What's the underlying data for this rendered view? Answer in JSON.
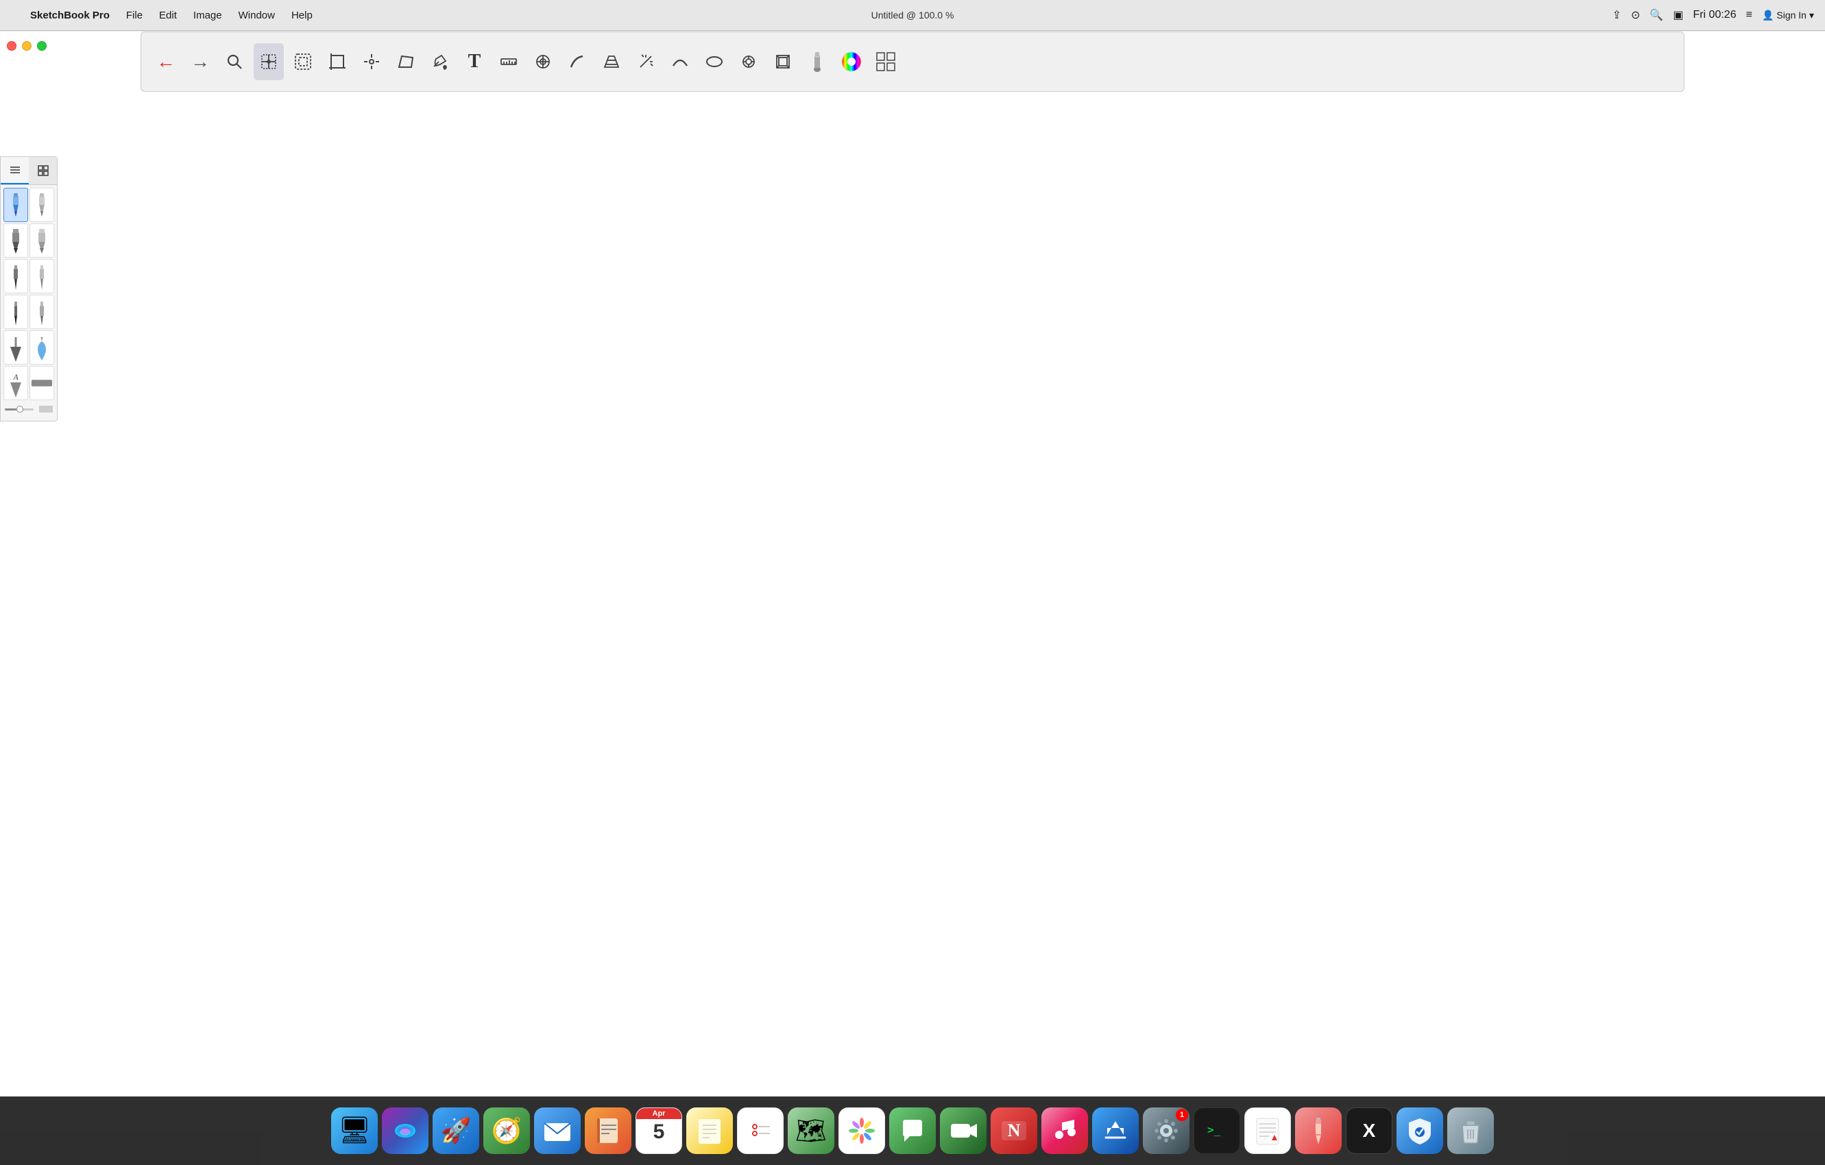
{
  "menubar": {
    "title": "Untitled @ 100.0 %",
    "apple_label": "",
    "app_name": "SketchBook Pro",
    "menus": [
      "File",
      "Edit",
      "Image",
      "Window",
      "Help"
    ],
    "time": "Fri 00:26",
    "sign_in": "Sign In"
  },
  "toolbar": {
    "buttons": [
      {
        "name": "undo",
        "icon": "←",
        "label": "Undo"
      },
      {
        "name": "redo",
        "icon": "→",
        "label": "Redo"
      },
      {
        "name": "zoom",
        "icon": "🔍",
        "label": "Zoom"
      },
      {
        "name": "select-move",
        "icon": "⊹",
        "label": "Select/Move"
      },
      {
        "name": "lasso-select",
        "icon": "⬚",
        "label": "Lasso Select"
      },
      {
        "name": "crop",
        "icon": "⬜",
        "label": "Crop"
      },
      {
        "name": "transform",
        "icon": "⊕",
        "label": "Transform"
      },
      {
        "name": "distort",
        "icon": "⬡",
        "label": "Distort"
      },
      {
        "name": "paint-bucket",
        "icon": "🪣",
        "label": "Paint Bucket"
      },
      {
        "name": "text",
        "icon": "T",
        "label": "Text"
      },
      {
        "name": "ruler",
        "icon": "📏",
        "label": "Ruler"
      },
      {
        "name": "symmetry",
        "icon": "◎",
        "label": "Symmetry"
      },
      {
        "name": "stroke",
        "icon": "∫",
        "label": "Stroke"
      },
      {
        "name": "perspective",
        "icon": "⬡",
        "label": "Perspective"
      },
      {
        "name": "magic-wand",
        "icon": "✳",
        "label": "Magic Wand"
      },
      {
        "name": "curve",
        "icon": "⌒",
        "label": "Curve"
      },
      {
        "name": "ellipse",
        "icon": "◯",
        "label": "Ellipse"
      },
      {
        "name": "puck",
        "icon": "⊙",
        "label": "Puck"
      },
      {
        "name": "layers",
        "icon": "⧉",
        "label": "Layers"
      },
      {
        "name": "brushes-marker",
        "icon": "✒",
        "label": "Brushes"
      },
      {
        "name": "color-wheel",
        "icon": "🎨",
        "label": "Color Wheel"
      },
      {
        "name": "brush-library",
        "icon": "⊞",
        "label": "Brush Library"
      }
    ]
  },
  "brush_panel": {
    "tabs": [
      {
        "name": "list-view",
        "icon": "≡"
      },
      {
        "name": "grid-view",
        "icon": "⊞"
      }
    ],
    "brushes": [
      {
        "name": "pencil-blue",
        "type": "pencil",
        "selected": true
      },
      {
        "name": "pencil-gray",
        "type": "pencil-gray"
      },
      {
        "name": "marker-dark",
        "type": "marker"
      },
      {
        "name": "marker-light",
        "type": "marker-light"
      },
      {
        "name": "pen-fine",
        "type": "pen"
      },
      {
        "name": "pen-gray",
        "type": "pen-gray"
      },
      {
        "name": "brush-thin",
        "type": "brush-thin"
      },
      {
        "name": "brush-medium",
        "type": "brush-medium"
      },
      {
        "name": "brush-triangle",
        "type": "brush-triangle"
      },
      {
        "name": "brush-drop",
        "type": "brush-drop"
      },
      {
        "name": "brush-a",
        "type": "brush-a"
      },
      {
        "name": "brush-rect",
        "type": "brush-rect"
      }
    ]
  },
  "dock": {
    "items": [
      {
        "name": "finder",
        "label": "Finder",
        "icon": "🖥",
        "class": "dock-finder"
      },
      {
        "name": "siri",
        "label": "Siri",
        "icon": "◉",
        "class": "dock-siri"
      },
      {
        "name": "launchpad",
        "label": "Launchpad",
        "icon": "🚀",
        "class": "dock-launchpad"
      },
      {
        "name": "safari",
        "label": "Safari",
        "icon": "🧭",
        "class": "dock-safari"
      },
      {
        "name": "mail",
        "label": "Mail",
        "icon": "✉",
        "class": "dock-mail"
      },
      {
        "name": "contacts",
        "label": "Contacts",
        "icon": "📖",
        "class": "dock-contacts"
      },
      {
        "name": "calendar",
        "label": "Calendar",
        "icon": "📅",
        "class": "dock-calendar",
        "badge": null
      },
      {
        "name": "notes",
        "label": "Notes",
        "icon": "📝",
        "class": "dock-notes"
      },
      {
        "name": "reminders",
        "label": "Reminders",
        "icon": "📋",
        "class": "dock-reminders"
      },
      {
        "name": "maps",
        "label": "Maps",
        "icon": "🗺",
        "class": "dock-maps"
      },
      {
        "name": "photos",
        "label": "Photos",
        "icon": "🌸",
        "class": "dock-photos"
      },
      {
        "name": "messages",
        "label": "Messages",
        "icon": "💬",
        "class": "dock-messages"
      },
      {
        "name": "facetime",
        "label": "FaceTime",
        "icon": "📹",
        "class": "dock-facetime"
      },
      {
        "name": "news",
        "label": "News",
        "icon": "📰",
        "class": "dock-news"
      },
      {
        "name": "music",
        "label": "Music",
        "icon": "♪",
        "class": "dock-music"
      },
      {
        "name": "appstore",
        "label": "App Store",
        "icon": "A",
        "class": "dock-appstore"
      },
      {
        "name": "sysprefs",
        "label": "System Preferences",
        "icon": "⚙",
        "class": "dock-sysprefs",
        "badge": "1"
      },
      {
        "name": "terminal",
        "label": "Terminal",
        "icon": ">_",
        "class": "dock-terminal"
      },
      {
        "name": "textedit",
        "label": "TextEdit",
        "icon": "📄",
        "class": "dock-textedit"
      },
      {
        "name": "pencil-app",
        "label": "Pencil",
        "icon": "✏",
        "class": "dock-pencil"
      },
      {
        "name": "sketchbook",
        "label": "SketchBook",
        "icon": "X",
        "class": "dock-sketch"
      },
      {
        "name": "adguard",
        "label": "AdGuard",
        "icon": "🛡",
        "class": "dock-adguard"
      },
      {
        "name": "trash",
        "label": "Trash",
        "icon": "🗑",
        "class": "dock-trash"
      }
    ]
  },
  "colors": {
    "menubar_bg": "#e6e6e6",
    "toolbar_bg": "#f0f0f0",
    "canvas_bg": "#ffffff",
    "brush_panel_bg": "#f5f5f5",
    "dock_bg": "#1e1e1e",
    "selected_brush_bg": "#cce0ff",
    "accent": "#007aff"
  }
}
